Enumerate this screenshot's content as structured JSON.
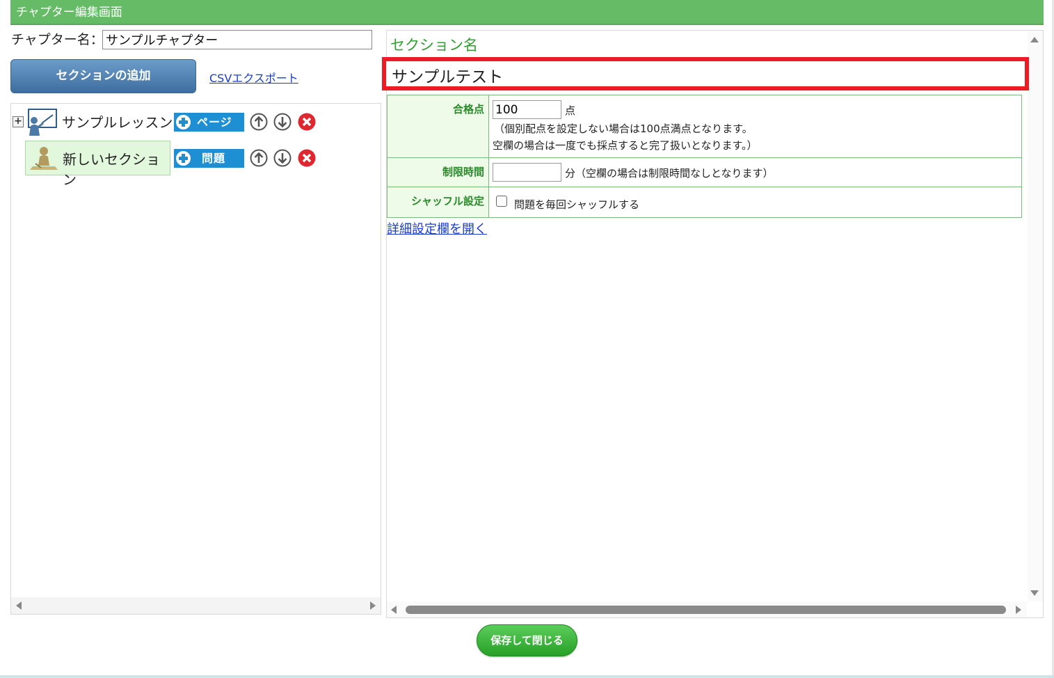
{
  "window": {
    "title": "チャプター編集画面"
  },
  "chapter": {
    "label": "チャプター名：",
    "name_value": "サンプルチャプター"
  },
  "toolbar": {
    "add_section_label": "セクションの追加",
    "csv_export_label": "CSVエクスポート"
  },
  "tree": {
    "expand_symbol": "+",
    "items": [
      {
        "label": "サンプルレッスン",
        "type": "lesson",
        "button_label": "ページ"
      },
      {
        "label": "新しいセクション",
        "type": "section",
        "button_label": "問題",
        "selected": true
      }
    ]
  },
  "section": {
    "name_label": "セクション名",
    "name_value": "サンプルテスト",
    "settings": {
      "pass_score": {
        "label": "合格点",
        "value": "100",
        "unit": "点",
        "note1": "（個別配点を設定しない場合は100点満点となります。",
        "note2": "空欄の場合は一度でも採点すると完了扱いとなります。）"
      },
      "time_limit": {
        "label": "制限時間",
        "value": "",
        "note": "分（空欄の場合は制限時間なしとなります）"
      },
      "shuffle": {
        "label": "シャッフル設定",
        "checkbox_label": "問題を毎回シャッフルする",
        "checked": false
      }
    },
    "detail_link": "詳細設定欄を開く"
  },
  "footer": {
    "save_label": "保存して閉じる"
  },
  "colors": {
    "title_bar": "#66bb66",
    "highlight_border": "#ee1b24",
    "accent_blue": "#1f8fd3",
    "save_green": "#33aa33"
  }
}
